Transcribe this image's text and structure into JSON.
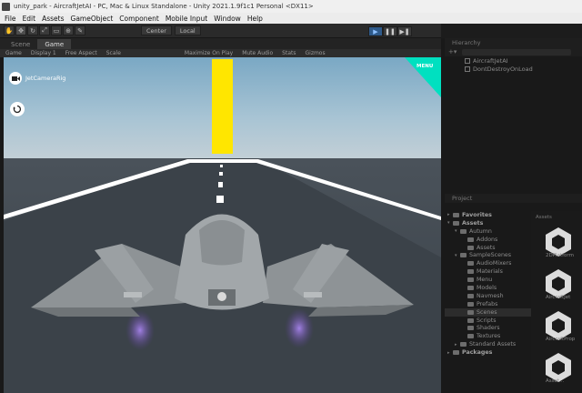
{
  "window": {
    "title": "unity_park - AircraftJetAI - PC, Mac & Linux Standalone - Unity 2021.1.9f1c1 Personal <DX11>"
  },
  "menu": [
    "File",
    "Edit",
    "Assets",
    "GameObject",
    "Component",
    "Mobile Input",
    "Window",
    "Help"
  ],
  "toolbar": {
    "pivot_label": "Center",
    "space_label": "Local"
  },
  "game_tabs": [
    "Scene",
    "Game"
  ],
  "game_options": [
    "Game",
    "Display 1",
    "Free Aspect",
    "Scale",
    "Maximize On Play",
    "Mute Audio",
    "Stats",
    "Gizmos"
  ],
  "game_ui": {
    "camera_label": "JetCameraRig",
    "menu_label": "MENU"
  },
  "hierarchy": {
    "tab": "Hierarchy",
    "items": [
      "AircraftJetAI",
      "DontDestroyOnLoad"
    ]
  },
  "project": {
    "tab": "Project",
    "tree": [
      {
        "label": "Favorites",
        "level": 0,
        "bold": true,
        "arrow": "▸"
      },
      {
        "label": "Assets",
        "level": 0,
        "bold": true,
        "arrow": "▾"
      },
      {
        "label": "Autumn",
        "level": 1,
        "arrow": "▾"
      },
      {
        "label": "Addons",
        "level": 2,
        "arrow": ""
      },
      {
        "label": "Assets",
        "level": 2,
        "arrow": ""
      },
      {
        "label": "SampleScenes",
        "level": 1,
        "arrow": "▾"
      },
      {
        "label": "AudioMixers",
        "level": 2,
        "arrow": ""
      },
      {
        "label": "Materials",
        "level": 2,
        "arrow": ""
      },
      {
        "label": "Menu",
        "level": 2,
        "arrow": ""
      },
      {
        "label": "Models",
        "level": 2,
        "arrow": ""
      },
      {
        "label": "Navmesh",
        "level": 2,
        "arrow": ""
      },
      {
        "label": "Prefabs",
        "level": 2,
        "arrow": ""
      },
      {
        "label": "Scenes",
        "level": 2,
        "arrow": "",
        "selected": true
      },
      {
        "label": "Scripts",
        "level": 2,
        "arrow": ""
      },
      {
        "label": "Shaders",
        "level": 2,
        "arrow": ""
      },
      {
        "label": "Textures",
        "level": 2,
        "arrow": ""
      },
      {
        "label": "Standard Assets",
        "level": 1,
        "arrow": "▸"
      },
      {
        "label": "Packages",
        "level": 0,
        "bold": true,
        "arrow": "▸"
      }
    ],
    "breadcrumb": "Assets",
    "assets": [
      "2DPlatform",
      "AircraftJet",
      "AircraftProp",
      "Asset..."
    ]
  }
}
